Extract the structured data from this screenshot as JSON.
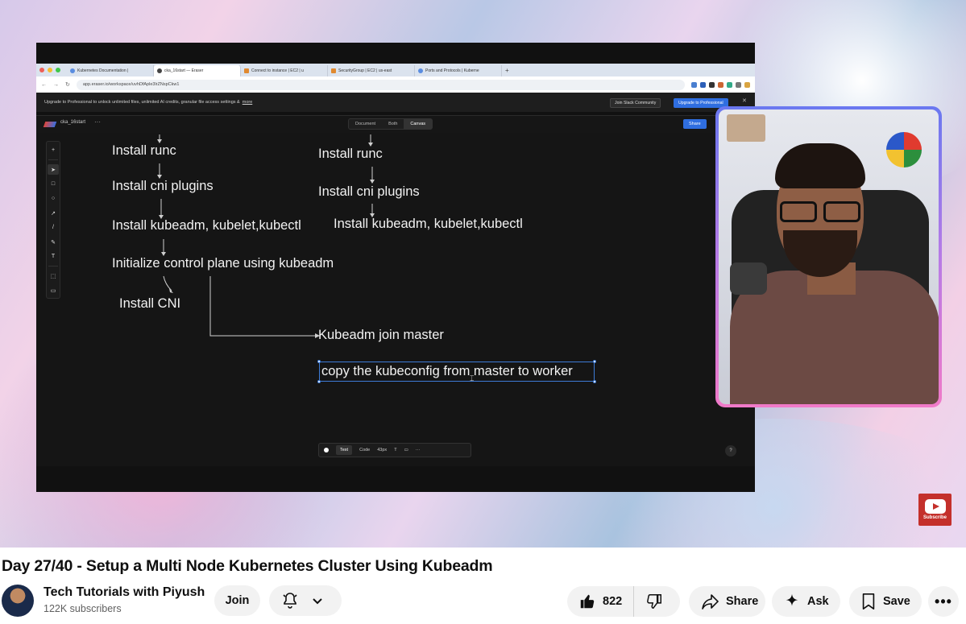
{
  "browser": {
    "tabs": [
      {
        "label": "Kubernetes Documentation |",
        "active": false
      },
      {
        "label": "cka_16start — Eraser",
        "active": true
      },
      {
        "label": "Connect to instance | EC2 | u",
        "active": false
      },
      {
        "label": "SecurityGroup | EC2 | us-east",
        "active": false
      },
      {
        "label": "Ports and Protocols | Kuberne",
        "active": false
      }
    ],
    "url": "app.eraser.io/workspace/uvhDfAple3lrZNspCkw1"
  },
  "banner": {
    "text": "Upgrade to Professional to unlock unlimited files, unlimited AI credits, granular file access settings &",
    "more": "more",
    "slack_button": "Join Slack Community",
    "pro_button": "Upgrade to Professional"
  },
  "eraser": {
    "file_name": "cka_16start",
    "views": [
      "Document",
      "Both",
      "Canvas"
    ],
    "active_view": "Canvas",
    "share_label": "Share",
    "left_steps": [
      "Install runc",
      "Install cni plugins",
      "Install kubeadm, kubelet,kubectl",
      "Initialize control plane using kubeadm",
      "Install CNI"
    ],
    "right_steps": [
      "Install runc",
      "Install cni plugins",
      "Install kubeadm, kubelet,kubectl"
    ],
    "join_text": "Kubeadm join master",
    "selected_text": "copy the kubeconfig from master to worker",
    "format_bar": {
      "text_tab": "Text",
      "code_tab": "Code",
      "size": "43px",
      "font": "T"
    },
    "help": "?"
  },
  "subscribe_badge": "Subscribe",
  "video": {
    "title": "Day 27/40 - Setup a Multi Node Kubernetes Cluster Using Kubeadm"
  },
  "channel": {
    "name": "Tech Tutorials with Piyush",
    "subscribers": "122K subscribers",
    "join_label": "Join"
  },
  "actions": {
    "likes": "822",
    "share": "Share",
    "ask": "Ask",
    "save": "Save"
  }
}
